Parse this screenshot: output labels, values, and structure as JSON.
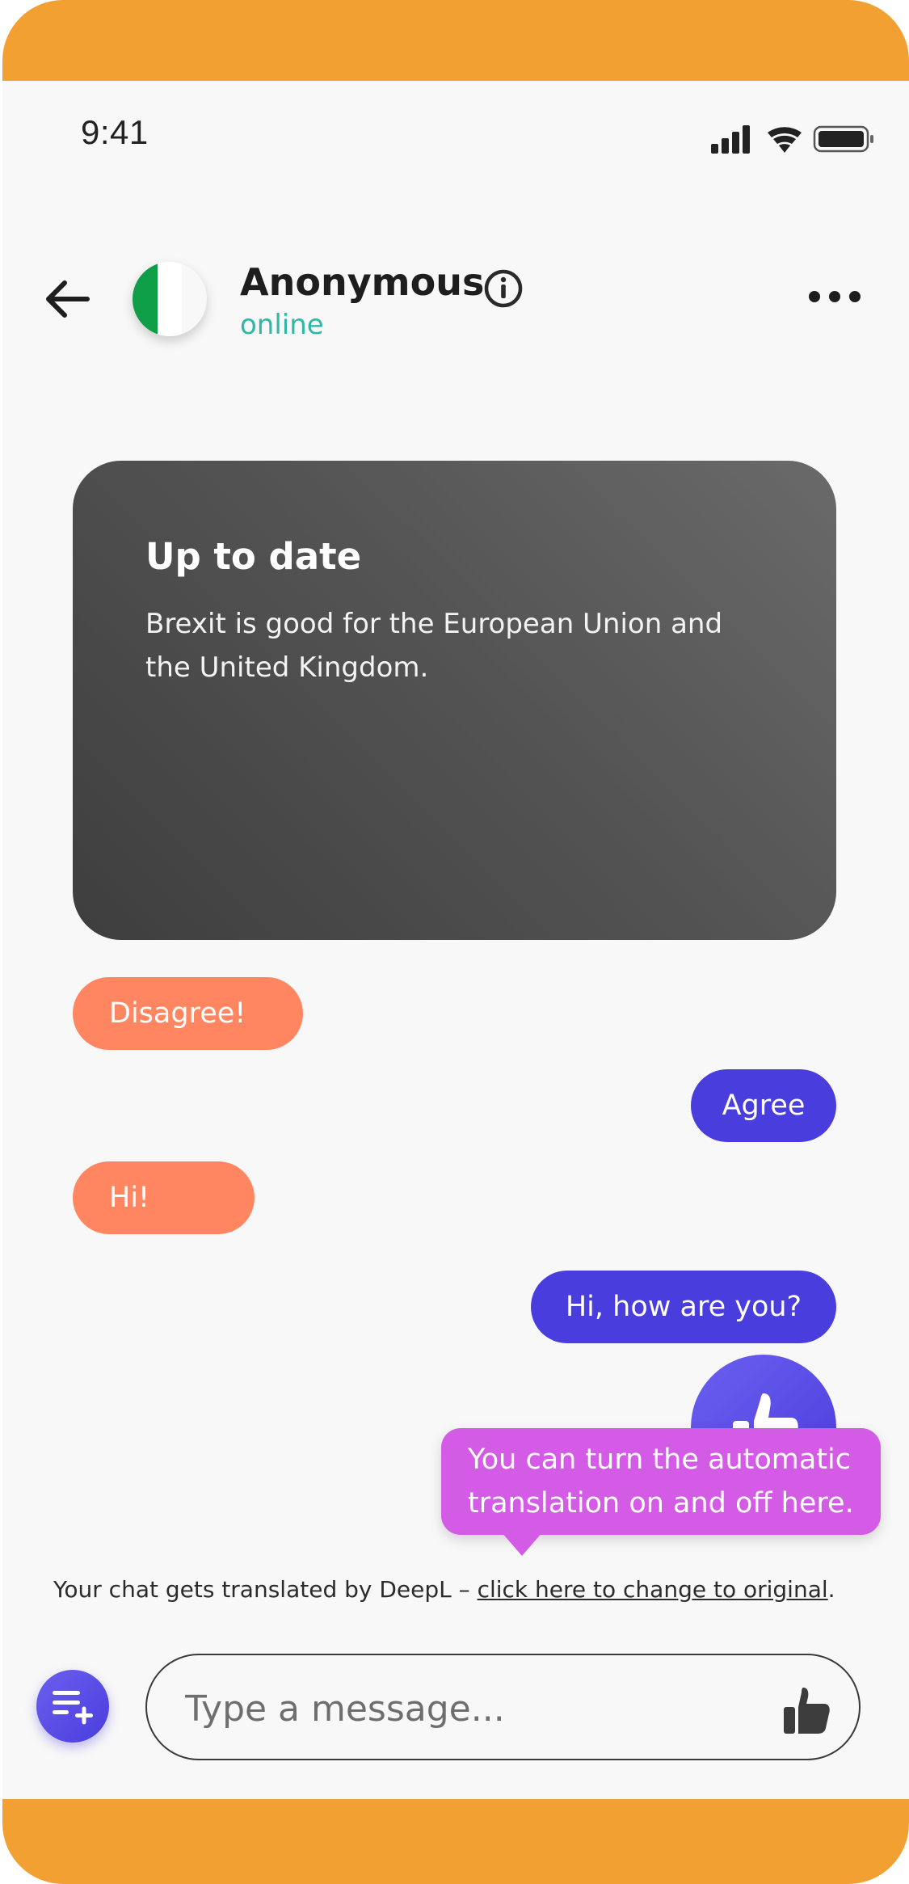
{
  "status_bar": {
    "time": "9:41"
  },
  "header": {
    "back_icon": "arrow-left-icon",
    "avatar_icon": "italy-flag-icon",
    "name": "Anonymous",
    "info_icon": "info-icon",
    "presence": "online",
    "menu_icon": "more-horizontal-icon"
  },
  "topic_card": {
    "title": "Up to date",
    "body": "Brexit is good for the European Union and the United Kingdom."
  },
  "messages": [
    {
      "direction": "incoming",
      "text": "Disagree!"
    },
    {
      "direction": "outgoing",
      "text": "Agree"
    },
    {
      "direction": "incoming",
      "text": "Hi!"
    },
    {
      "direction": "outgoing",
      "text": "Hi, how are you?"
    }
  ],
  "translate_fab": {
    "icon": "thumbs-up-icon"
  },
  "tooltip": {
    "text": "You can turn the automatic translation on and off here."
  },
  "translation_note": {
    "prefix": "Your chat gets translated by DeepL – ",
    "link": "click here to change to original",
    "suffix": "."
  },
  "composer": {
    "attach_icon": "playlist-add-icon",
    "placeholder": "Type a message...",
    "send_icon": "thumbs-up-icon"
  },
  "colors": {
    "frame": "#F2A032",
    "incoming_bubble": "#FF8660",
    "outgoing_bubble": "#4A3DDD",
    "presence": "#2FB8A6",
    "tooltip": "#D45BE6"
  }
}
